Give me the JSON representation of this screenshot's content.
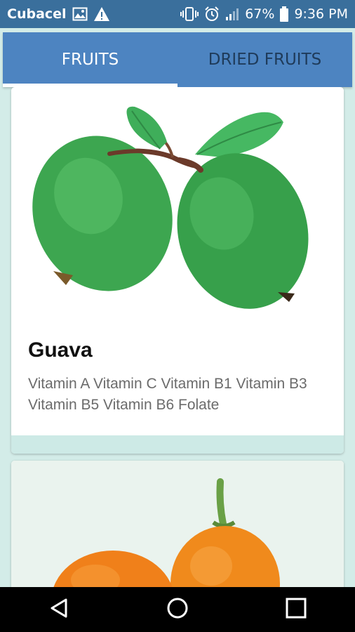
{
  "status_bar": {
    "carrier": "Cubacel",
    "battery": "67%",
    "time": "9:36 PM",
    "icons": [
      "image-icon",
      "warning-icon",
      "vibrate-icon",
      "alarm-icon",
      "signal-icon",
      "battery-icon"
    ]
  },
  "tabs": [
    {
      "label": "FRUITS",
      "selected": true
    },
    {
      "label": "DRIED FRUITS",
      "selected": false
    }
  ],
  "cards": [
    {
      "title": "Guava",
      "description": "Vitamin A Vitamin C Vitamin B1 Vitamin B3 Vitamin B5 Vitamin B6 Folate",
      "image": "guava-image"
    },
    {
      "title": "",
      "description": "",
      "image": "kumquat-image"
    }
  ],
  "nav": {
    "icons": [
      "back-icon",
      "home-icon",
      "recents-icon"
    ]
  },
  "colors": {
    "status_bar": "#3a6f9c",
    "tab_bar": "#4d84c1",
    "tab_selected_text": "#ffffff",
    "tab_unselected_text": "#1f3b5a",
    "background": "#d3ece8"
  }
}
